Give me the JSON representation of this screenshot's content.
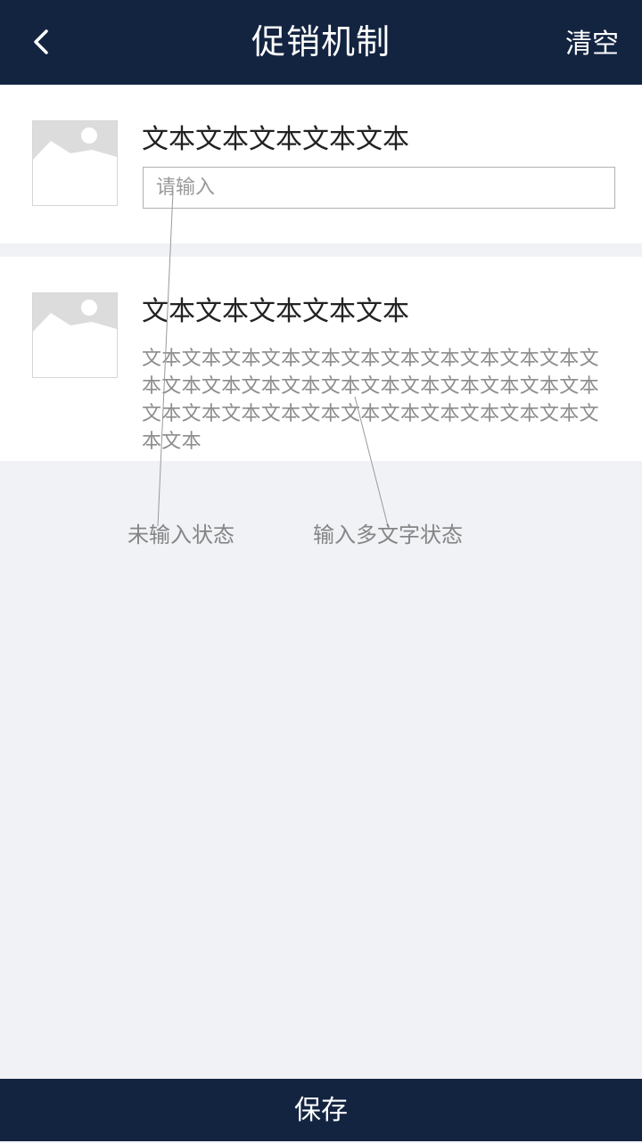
{
  "header": {
    "back_icon": "chevron-left-icon",
    "title": "促销机制",
    "clear_label": "清空"
  },
  "items": [
    {
      "image_icon": "image-placeholder-icon",
      "title": "文本文本文本文本文本",
      "input_placeholder": "请输入",
      "input_value": ""
    },
    {
      "image_icon": "image-placeholder-icon",
      "title": "文本文本文本文本文本",
      "text": "文本文本文本文本文本文本文本文本文本文本文本文本文本文本文本文本文本文本文本文本文本文本文本文本文本文本文本文本文本文本文本文本文本文本文本文本"
    }
  ],
  "annotations": {
    "empty_state": "未输入状态",
    "filled_state": "输入多文字状态"
  },
  "footer": {
    "save_label": "保存"
  },
  "colors": {
    "nav_background": "#132441",
    "page_background": "#f1f2f6",
    "card_background": "#ffffff"
  }
}
